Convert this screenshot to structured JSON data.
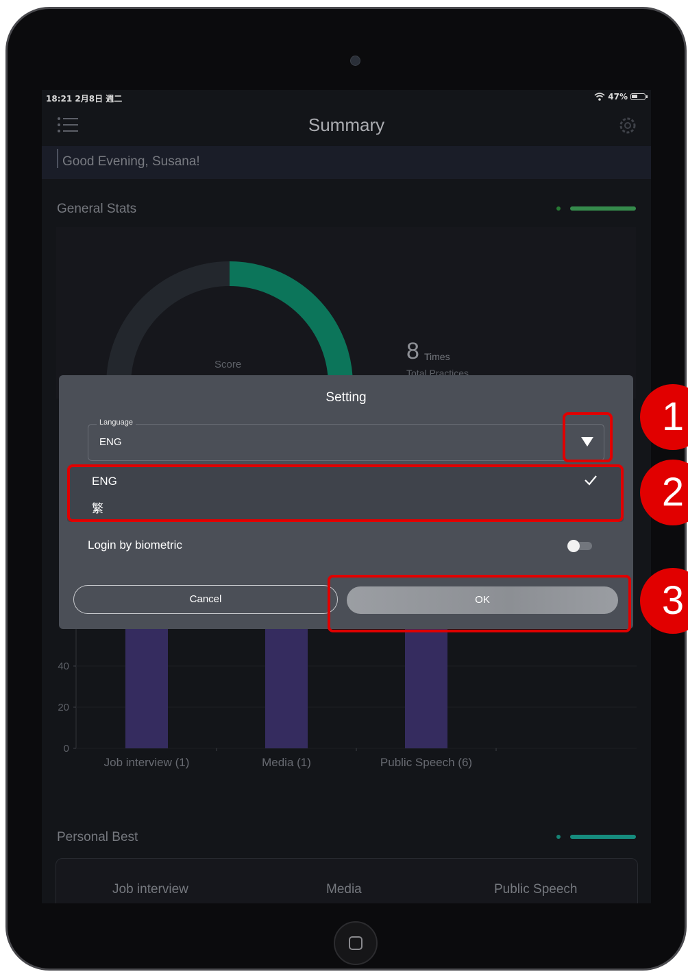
{
  "status_bar": {
    "time_date": "18:21  2月8日 週二",
    "battery": "47%",
    "battery_level": 0.47
  },
  "nav": {
    "title": "Summary"
  },
  "greeting": "Good Evening, Susana!",
  "general_stats": {
    "title": "General Stats",
    "score_label": "Score",
    "score_fraction": 0.37,
    "practices_value": "8",
    "practices_unit": "Times",
    "practices_label": "Total Practices"
  },
  "dialog": {
    "title": "Setting",
    "language_label": "Language",
    "language_value": "ENG",
    "options": [
      {
        "label": "ENG",
        "selected": true
      },
      {
        "label": "繁",
        "selected": false
      }
    ],
    "biometric_label": "Login by biometric",
    "biometric_enabled": false,
    "cancel_label": "Cancel",
    "ok_label": "OK"
  },
  "annotations": [
    "1",
    "2",
    "3"
  ],
  "personal_best": {
    "title": "Personal Best",
    "columns": [
      "Job interview",
      "Media",
      "Public Speech"
    ]
  },
  "colors": {
    "accent_green": "#0f8a6a",
    "bar_purple": "#3f3470",
    "annotation_red": "#e00000"
  },
  "chart_data": {
    "type": "bar",
    "categories": [
      "Job interview (1)",
      "Media (1)",
      "Public Speech (6)"
    ],
    "values": [
      88,
      84,
      85
    ],
    "yticks": [
      0,
      20,
      40
    ],
    "ylim": [
      0,
      100
    ]
  }
}
